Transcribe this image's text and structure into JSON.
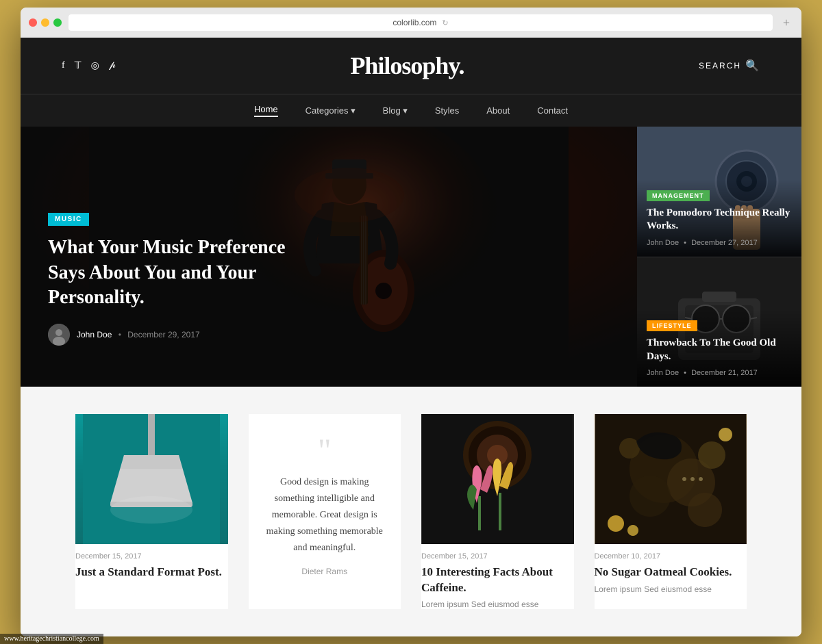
{
  "browser": {
    "url": "colorlib.com",
    "add_tab": "+"
  },
  "site": {
    "title": "Philosophy.",
    "search_label": "SEARCH"
  },
  "social": {
    "icons": [
      "f",
      "𝕏",
      "◎",
      "⊕"
    ]
  },
  "nav": {
    "items": [
      {
        "label": "Home",
        "active": true
      },
      {
        "label": "Categories",
        "dropdown": true
      },
      {
        "label": "Blog",
        "dropdown": true
      },
      {
        "label": "Styles"
      },
      {
        "label": "About"
      },
      {
        "label": "Contact"
      }
    ]
  },
  "hero": {
    "badge": "MUSIC",
    "title": "What Your Music Preference Says About You and Your Personality.",
    "author_name": "John Doe",
    "date": "December 29, 2017"
  },
  "side_cards": [
    {
      "badge": "MANAGEMENT",
      "title": "The Pomodoro Technique Really Works.",
      "author": "John Doe",
      "date": "December 27, 2017"
    },
    {
      "badge": "LIFESTYLE",
      "title": "Throwback To The Good Old Days.",
      "author": "John Doe",
      "date": "December 21, 2017"
    }
  ],
  "posts": [
    {
      "type": "image-lamp",
      "date": "December 15, 2017",
      "title": "Just a Standard Format Post."
    },
    {
      "type": "quote",
      "quote": "Good design is making something intelligible and memorable. Great design is making something memorable and meaningful.",
      "author": "Dieter Rams"
    },
    {
      "type": "image-coffee",
      "date": "December 15, 2017",
      "title": "10 Interesting Facts About Caffeine.",
      "excerpt": "Lorem ipsum Sed eiusmod esse"
    },
    {
      "type": "image-food",
      "date": "December 10, 2017",
      "title": "No Sugar Oatmeal Cookies.",
      "excerpt": "Lorem ipsum Sed eiusmod esse"
    }
  ],
  "footer_url": "www.heritagechristiancollege.com"
}
